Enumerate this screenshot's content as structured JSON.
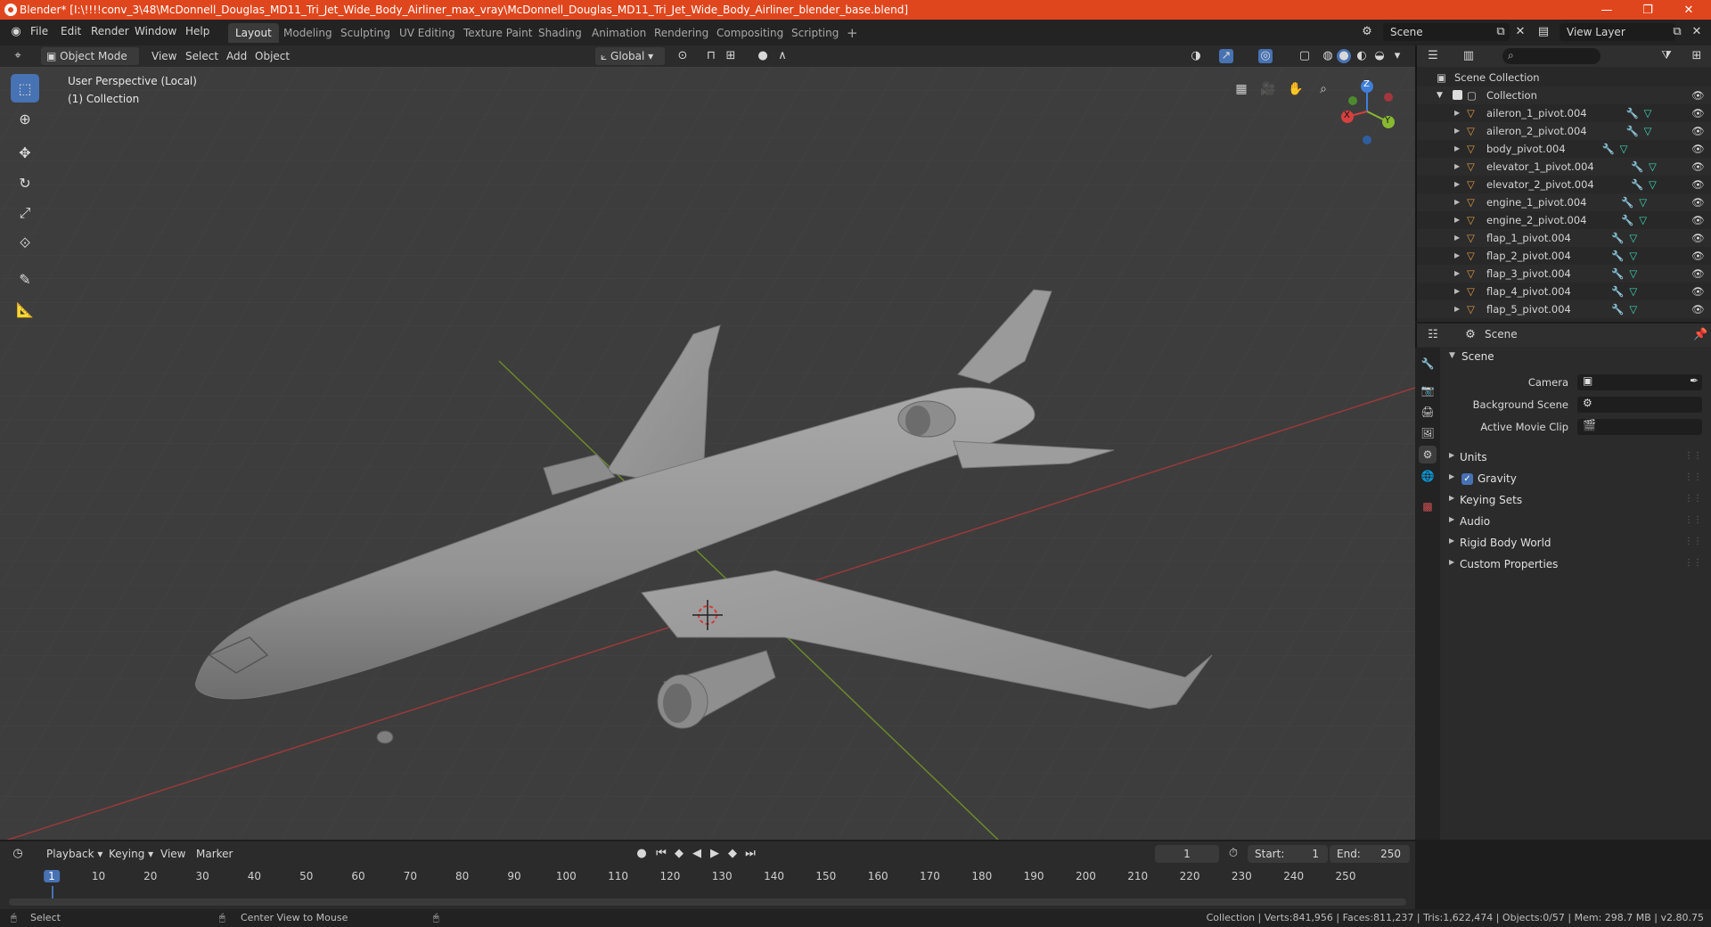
{
  "titlebar": {
    "title": "Blender* [I:\\!!!!conv_3\\48\\McDonnell_Douglas_MD11_Tri_Jet_Wide_Body_Airliner_max_vray\\McDonnell_Douglas_MD11_Tri_Jet_Wide_Body_Airliner_blender_base.blend]",
    "minimize": "—",
    "maximize": "❐",
    "close": "✕"
  },
  "menu": {
    "file": "File",
    "edit": "Edit",
    "render": "Render",
    "window": "Window",
    "help": "Help"
  },
  "workspaces": [
    "Layout",
    "Modeling",
    "Sculpting",
    "UV Editing",
    "Texture Paint",
    "Shading",
    "Animation",
    "Rendering",
    "Compositing",
    "Scripting"
  ],
  "workspace_add": "+",
  "scene_field": "Scene",
  "viewlayer_field": "View Layer",
  "viewport_header": {
    "mode": "Object Mode",
    "view": "View",
    "select": "Select",
    "add": "Add",
    "object": "Object",
    "orientation": "Global"
  },
  "viewport": {
    "perspective": "User Perspective (Local)",
    "collection": "(1) Collection",
    "gizmo_x": "X",
    "gizmo_y": "Y",
    "gizmo_z": "Z"
  },
  "outliner": {
    "root": "Scene Collection",
    "collection": "Collection",
    "items": [
      "aileron_1_pivot.004",
      "aileron_2_pivot.004",
      "body_pivot.004",
      "elevator_1_pivot.004",
      "elevator_2_pivot.004",
      "engine_1_pivot.004",
      "engine_2_pivot.004",
      "flap_1_pivot.004",
      "flap_2_pivot.004",
      "flap_3_pivot.004",
      "flap_4_pivot.004",
      "flap_5_pivot.004"
    ]
  },
  "properties": {
    "header": "Scene",
    "section": "Scene",
    "camera_label": "Camera",
    "background_label": "Background Scene",
    "movieclip_label": "Active Movie Clip",
    "panels": [
      "Units",
      "Gravity",
      "Keying Sets",
      "Audio",
      "Rigid Body World",
      "Custom Properties"
    ],
    "gravity_checked": true
  },
  "timeline": {
    "playback": "Playback",
    "keying": "Keying",
    "view": "View",
    "marker": "Marker",
    "current_frame": "1",
    "start_label": "Start:",
    "start_value": "1",
    "end_label": "End:",
    "end_value": "250",
    "ruler": [
      "1",
      "10",
      "20",
      "30",
      "40",
      "50",
      "60",
      "70",
      "80",
      "90",
      "100",
      "110",
      "120",
      "130",
      "140",
      "150",
      "160",
      "170",
      "180",
      "190",
      "200",
      "210",
      "220",
      "230",
      "240",
      "250"
    ]
  },
  "statusbar": {
    "select": "Select",
    "center_view": "Center View to Mouse",
    "stats": "Collection | Verts:841,956 | Faces:811,237 | Tris:1,622,474 | Objects:0/57 | Mem: 298.7 MB | v2.80.75"
  },
  "colors": {
    "titlebar": "#e0461d",
    "accent": "#4772b3",
    "viewport_bg": "#3d3d3d",
    "x_axis": "#d64040",
    "y_axis": "#89b832",
    "z_axis": "#3f7fd8"
  }
}
